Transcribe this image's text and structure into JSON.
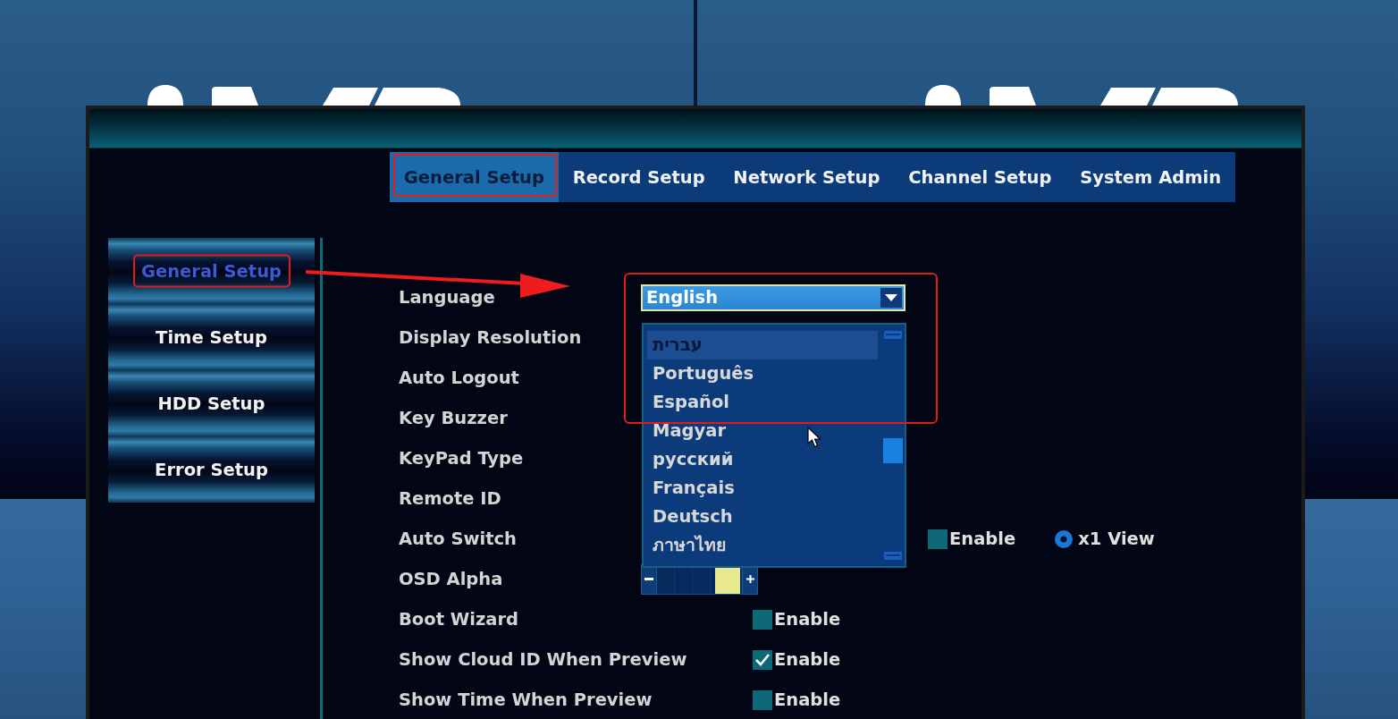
{
  "tabs": [
    {
      "label": "General Setup",
      "selected": true,
      "annotated": true
    },
    {
      "label": "Record Setup",
      "selected": false,
      "annotated": false
    },
    {
      "label": "Network Setup",
      "selected": false,
      "annotated": false
    },
    {
      "label": "Channel Setup",
      "selected": false,
      "annotated": false
    },
    {
      "label": "System Admin",
      "selected": false,
      "annotated": false
    }
  ],
  "sidebar": {
    "items": [
      {
        "label": "General Setup",
        "selected": true,
        "annotated": true
      },
      {
        "label": "Time Setup",
        "selected": false,
        "annotated": false
      },
      {
        "label": "HDD Setup",
        "selected": false,
        "annotated": false
      },
      {
        "label": "Error Setup",
        "selected": false,
        "annotated": false
      }
    ]
  },
  "form": {
    "rows": [
      {
        "kind": "dropdown",
        "label": "Language",
        "value": "English",
        "annotated": true,
        "options": [
          {
            "label": "עברית",
            "selected": true
          },
          {
            "label": "Português",
            "selected": false
          },
          {
            "label": "Español",
            "selected": false
          },
          {
            "label": "Magyar",
            "selected": false
          },
          {
            "label": "русский",
            "selected": false
          },
          {
            "label": "Français",
            "selected": false
          },
          {
            "label": "Deutsch",
            "selected": false
          },
          {
            "label": "ภาษาไทย",
            "selected": false
          }
        ]
      },
      {
        "kind": "plain",
        "label": "Display Resolution"
      },
      {
        "kind": "plain",
        "label": "Auto Logout"
      },
      {
        "kind": "plain",
        "label": "Key Buzzer"
      },
      {
        "kind": "plain",
        "label": "KeyPad Type"
      },
      {
        "kind": "plain",
        "label": "Remote ID"
      },
      {
        "kind": "switch",
        "label": "Auto Switch",
        "checkbox": {
          "label": "Enable",
          "checked": false
        },
        "radio": {
          "label": "x1 View",
          "selected": true
        }
      },
      {
        "kind": "slider",
        "label": "OSD Alpha",
        "level": 0.97
      },
      {
        "kind": "checkbox",
        "label": "Boot Wizard",
        "checkbox": {
          "label": "Enable",
          "checked": false
        }
      },
      {
        "kind": "checkbox",
        "label": "Show Cloud ID When Preview",
        "checkbox": {
          "label": "Enable",
          "checked": true
        }
      },
      {
        "kind": "checkbox",
        "label": "Show Time When Preview",
        "checkbox": {
          "label": "Enable",
          "checked": false
        }
      }
    ]
  }
}
